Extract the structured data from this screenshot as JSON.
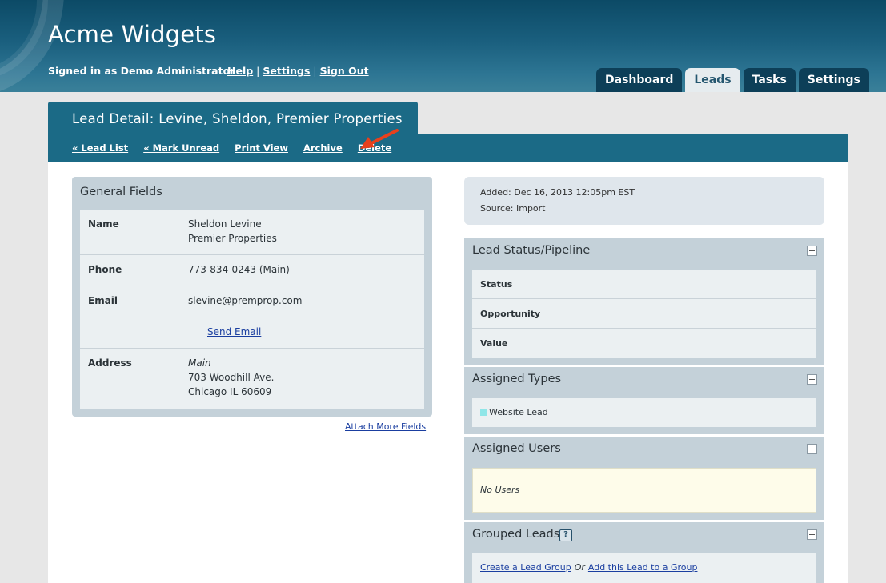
{
  "app": {
    "title": "Acme Widgets"
  },
  "header": {
    "signed_in": "Signed in as Demo Administrator",
    "links": {
      "help": "Help",
      "settings": "Settings",
      "sign_out": "Sign Out"
    },
    "separator": "|"
  },
  "tabs": [
    {
      "label": "Dashboard",
      "active": false
    },
    {
      "label": "Leads",
      "active": true
    },
    {
      "label": "Tasks",
      "active": false
    },
    {
      "label": "Settings",
      "active": false
    }
  ],
  "page": {
    "title": "Lead Detail: Levine, Sheldon, Premier Properties",
    "actions": {
      "lead_list": "« Lead List",
      "mark_unread": "« Mark Unread",
      "print_view": "Print View",
      "archive": "Archive",
      "delete": "Delete"
    },
    "annotation_arrow_color": "#e8401c"
  },
  "general_fields": {
    "title": "General Fields",
    "name": {
      "label": "Name",
      "line1": "Sheldon Levine",
      "line2": "Premier Properties"
    },
    "phone": {
      "label": "Phone",
      "value": "773-834-0243 (Main)"
    },
    "email": {
      "label": "Email",
      "value": "slevine@premprop.com"
    },
    "send_email": "Send Email",
    "address": {
      "label": "Address",
      "type": "Main",
      "line1": "703 Woodhill Ave.",
      "line2": "Chicago IL 60609"
    },
    "attach_more": "Attach More Fields"
  },
  "meta": {
    "added": "Added: Dec 16, 2013 12:05pm EST",
    "source": "Source: Import"
  },
  "lead_status": {
    "title": "Lead Status/Pipeline",
    "rows": [
      "Status",
      "Opportunity",
      "Value"
    ]
  },
  "assigned_types": {
    "title": "Assigned Types",
    "items": [
      {
        "label": "Website Lead",
        "color": "#8fe6e8"
      }
    ]
  },
  "assigned_users": {
    "title": "Assigned Users",
    "empty": "No Users"
  },
  "grouped_leads": {
    "title": "Grouped Leads",
    "help_glyph": "?",
    "create": "Create a Lead Group",
    "or": "Or",
    "add": "Add this Lead to a Group"
  },
  "colors": {
    "header_dark": "#0c4a66",
    "accent": "#1b6a86",
    "panel": "#c4d1d9",
    "panel_inner": "#ebf0f2",
    "link": "#1a3ea0",
    "note_bg": "#fefcea"
  }
}
